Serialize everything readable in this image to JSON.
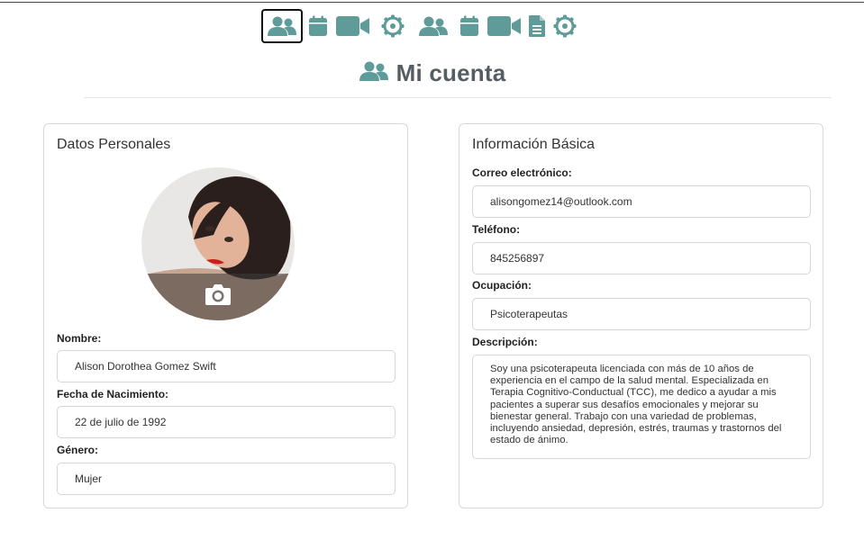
{
  "toolbar": {
    "icons": [
      "users-icon",
      "calendar-icon",
      "video-icon",
      "gear-icon",
      "users-icon",
      "calendar-icon",
      "video-icon",
      "document-icon",
      "gear-icon"
    ],
    "accent_color": "#5f9c99"
  },
  "header": {
    "title": "Mi cuenta",
    "icon": "users-icon"
  },
  "personal": {
    "title": "Datos Personales",
    "avatar_icon": "camera-icon",
    "name_label": "Nombre:",
    "name_value": "Alison Dorothea Gomez Swift",
    "dob_label": "Fecha de Nacimiento:",
    "dob_value": "22 de julio de 1992",
    "gender_label": "Género:",
    "gender_value": "Mujer"
  },
  "basic": {
    "title": "Información Básica",
    "email_label": "Correo electrónico:",
    "email_value": "alisongomez14@outlook.com",
    "phone_label": "Teléfono:",
    "phone_value": "845256897",
    "occupation_label": "Ocupación:",
    "occupation_value": "Psicoterapeutas",
    "description_label": "Descripción:",
    "description_value": "Soy una psicoterapeuta licenciada con más de 10 años de experiencia en el campo de la salud mental. Especializada en Terapia Cognitivo-Conductual (TCC), me dedico a ayudar a mis pacientes a superar sus desafíos emocionales y mejorar su bienestar general. Trabajo con una variedad de problemas, incluyendo ansiedad, depresión, estrés, traumas y trastornos del estado de ánimo."
  }
}
